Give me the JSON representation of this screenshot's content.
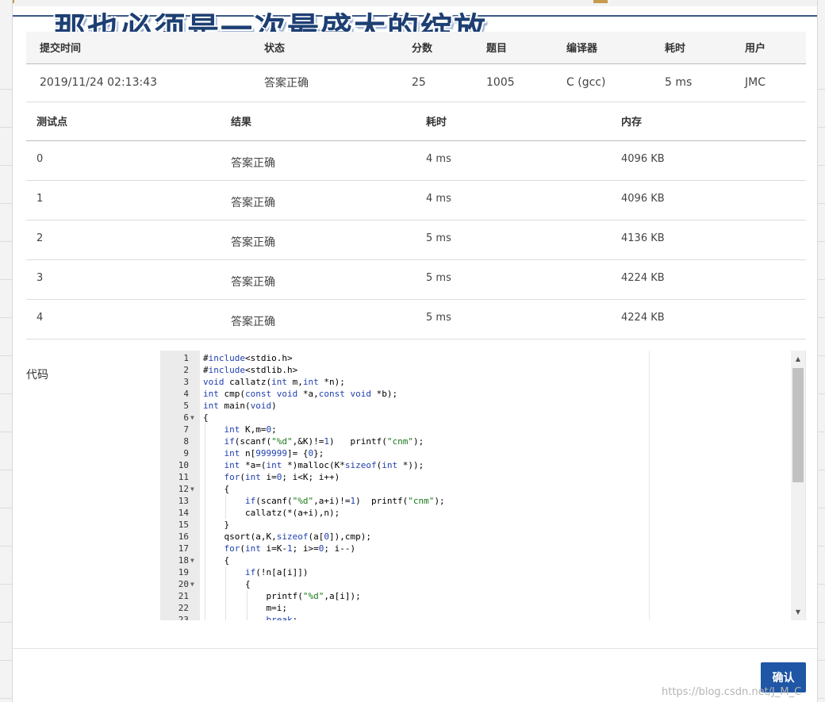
{
  "overlay_title": "那也必须是一次最盛大的绽放",
  "submission": {
    "headers": [
      "提交时间",
      "状态",
      "分数",
      "题目",
      "编译器",
      "耗时",
      "用户"
    ],
    "row": {
      "time": "2019/11/24 02:13:43",
      "status": "答案正确",
      "score": "25",
      "problem": "1005",
      "compiler": "C (gcc)",
      "elapsed": "5 ms",
      "user": "JMC"
    }
  },
  "cases": {
    "headers": [
      "测试点",
      "结果",
      "耗时",
      "内存"
    ],
    "rows": [
      {
        "id": "0",
        "result": "答案正确",
        "time": "4 ms",
        "memory": "4096 KB"
      },
      {
        "id": "1",
        "result": "答案正确",
        "time": "4 ms",
        "memory": "4096 KB"
      },
      {
        "id": "2",
        "result": "答案正确",
        "time": "5 ms",
        "memory": "4136 KB"
      },
      {
        "id": "3",
        "result": "答案正确",
        "time": "5 ms",
        "memory": "4224 KB"
      },
      {
        "id": "4",
        "result": "答案正确",
        "time": "5 ms",
        "memory": "4224 KB"
      }
    ]
  },
  "code_label": "代码",
  "code_lines": [
    {
      "n": "1",
      "fold": false,
      "text": "#include<stdio.h>"
    },
    {
      "n": "2",
      "fold": false,
      "text": "#include<stdlib.h>"
    },
    {
      "n": "3",
      "fold": false,
      "text": "void callatz(int m,int *n);"
    },
    {
      "n": "4",
      "fold": false,
      "text": "int cmp(const void *a,const void *b);"
    },
    {
      "n": "5",
      "fold": false,
      "text": "int main(void)"
    },
    {
      "n": "6",
      "fold": true,
      "text": "{"
    },
    {
      "n": "7",
      "fold": false,
      "text": "    int K,m=0;"
    },
    {
      "n": "8",
      "fold": false,
      "text": "    if(scanf(\"%d\",&K)!=1)   printf(\"cnm\");"
    },
    {
      "n": "9",
      "fold": false,
      "text": "    int n[999999]= {0};"
    },
    {
      "n": "10",
      "fold": false,
      "text": "    int *a=(int *)malloc(K*sizeof(int *));"
    },
    {
      "n": "11",
      "fold": false,
      "text": "    for(int i=0; i<K; i++)"
    },
    {
      "n": "12",
      "fold": true,
      "text": "    {"
    },
    {
      "n": "13",
      "fold": false,
      "text": "        if(scanf(\"%d\",a+i)!=1)  printf(\"cnm\");"
    },
    {
      "n": "14",
      "fold": false,
      "text": "        callatz(*(a+i),n);"
    },
    {
      "n": "15",
      "fold": false,
      "text": "    }"
    },
    {
      "n": "16",
      "fold": false,
      "text": "    qsort(a,K,sizeof(a[0]),cmp);"
    },
    {
      "n": "17",
      "fold": false,
      "text": "    for(int i=K-1; i>=0; i--)"
    },
    {
      "n": "18",
      "fold": true,
      "text": "    {"
    },
    {
      "n": "19",
      "fold": false,
      "text": "        if(!n[a[i]])"
    },
    {
      "n": "20",
      "fold": true,
      "text": "        {"
    },
    {
      "n": "21",
      "fold": false,
      "text": "            printf(\"%d\",a[i]);"
    },
    {
      "n": "22",
      "fold": false,
      "text": "            m=i;"
    },
    {
      "n": "23",
      "fold": false,
      "text": "            break;"
    }
  ],
  "confirm_label": "确认",
  "watermark": "https://blog.csdn.net/J_M_C"
}
